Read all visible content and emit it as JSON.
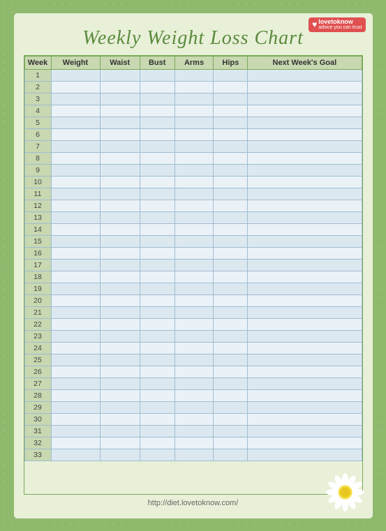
{
  "logo": {
    "brand": "lovetoknow",
    "tagline": "advice you can trust"
  },
  "title": "Weekly Weight Loss Chart",
  "columns": [
    "Week",
    "Weight",
    "Waist",
    "Bust",
    "Arms",
    "Hips",
    "Next Week's Goal"
  ],
  "rows": [
    1,
    2,
    3,
    4,
    5,
    6,
    7,
    8,
    9,
    10,
    11,
    12,
    13,
    14,
    15,
    16,
    17,
    18,
    19,
    20,
    21,
    22,
    23,
    24,
    25,
    26,
    27,
    28,
    29,
    30,
    31,
    32,
    33
  ],
  "footer": {
    "url": "http://diet.lovetoknow.com/"
  }
}
